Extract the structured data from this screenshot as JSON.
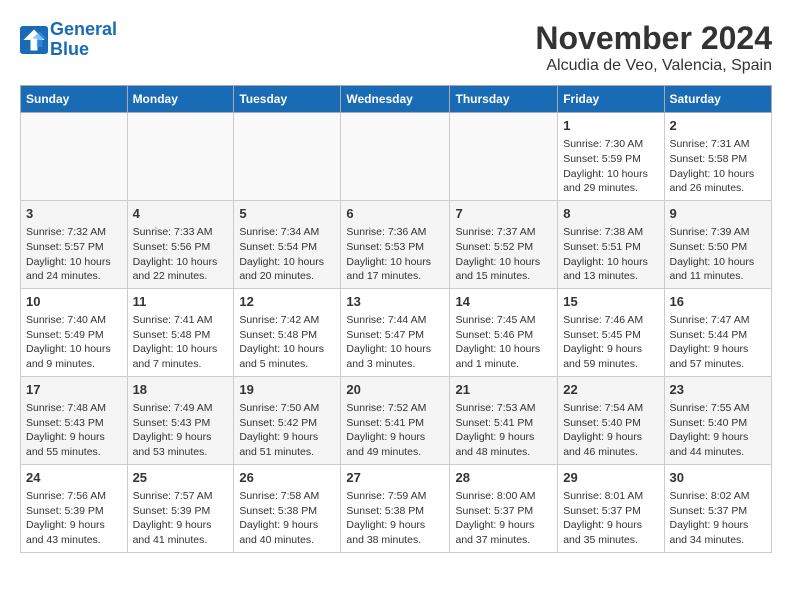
{
  "header": {
    "logo_line1": "General",
    "logo_line2": "Blue",
    "month": "November 2024",
    "location": "Alcudia de Veo, Valencia, Spain"
  },
  "weekdays": [
    "Sunday",
    "Monday",
    "Tuesday",
    "Wednesday",
    "Thursday",
    "Friday",
    "Saturday"
  ],
  "weeks": [
    [
      {
        "day": "",
        "info": ""
      },
      {
        "day": "",
        "info": ""
      },
      {
        "day": "",
        "info": ""
      },
      {
        "day": "",
        "info": ""
      },
      {
        "day": "",
        "info": ""
      },
      {
        "day": "1",
        "info": "Sunrise: 7:30 AM\nSunset: 5:59 PM\nDaylight: 10 hours and 29 minutes."
      },
      {
        "day": "2",
        "info": "Sunrise: 7:31 AM\nSunset: 5:58 PM\nDaylight: 10 hours and 26 minutes."
      }
    ],
    [
      {
        "day": "3",
        "info": "Sunrise: 7:32 AM\nSunset: 5:57 PM\nDaylight: 10 hours and 24 minutes."
      },
      {
        "day": "4",
        "info": "Sunrise: 7:33 AM\nSunset: 5:56 PM\nDaylight: 10 hours and 22 minutes."
      },
      {
        "day": "5",
        "info": "Sunrise: 7:34 AM\nSunset: 5:54 PM\nDaylight: 10 hours and 20 minutes."
      },
      {
        "day": "6",
        "info": "Sunrise: 7:36 AM\nSunset: 5:53 PM\nDaylight: 10 hours and 17 minutes."
      },
      {
        "day": "7",
        "info": "Sunrise: 7:37 AM\nSunset: 5:52 PM\nDaylight: 10 hours and 15 minutes."
      },
      {
        "day": "8",
        "info": "Sunrise: 7:38 AM\nSunset: 5:51 PM\nDaylight: 10 hours and 13 minutes."
      },
      {
        "day": "9",
        "info": "Sunrise: 7:39 AM\nSunset: 5:50 PM\nDaylight: 10 hours and 11 minutes."
      }
    ],
    [
      {
        "day": "10",
        "info": "Sunrise: 7:40 AM\nSunset: 5:49 PM\nDaylight: 10 hours and 9 minutes."
      },
      {
        "day": "11",
        "info": "Sunrise: 7:41 AM\nSunset: 5:48 PM\nDaylight: 10 hours and 7 minutes."
      },
      {
        "day": "12",
        "info": "Sunrise: 7:42 AM\nSunset: 5:48 PM\nDaylight: 10 hours and 5 minutes."
      },
      {
        "day": "13",
        "info": "Sunrise: 7:44 AM\nSunset: 5:47 PM\nDaylight: 10 hours and 3 minutes."
      },
      {
        "day": "14",
        "info": "Sunrise: 7:45 AM\nSunset: 5:46 PM\nDaylight: 10 hours and 1 minute."
      },
      {
        "day": "15",
        "info": "Sunrise: 7:46 AM\nSunset: 5:45 PM\nDaylight: 9 hours and 59 minutes."
      },
      {
        "day": "16",
        "info": "Sunrise: 7:47 AM\nSunset: 5:44 PM\nDaylight: 9 hours and 57 minutes."
      }
    ],
    [
      {
        "day": "17",
        "info": "Sunrise: 7:48 AM\nSunset: 5:43 PM\nDaylight: 9 hours and 55 minutes."
      },
      {
        "day": "18",
        "info": "Sunrise: 7:49 AM\nSunset: 5:43 PM\nDaylight: 9 hours and 53 minutes."
      },
      {
        "day": "19",
        "info": "Sunrise: 7:50 AM\nSunset: 5:42 PM\nDaylight: 9 hours and 51 minutes."
      },
      {
        "day": "20",
        "info": "Sunrise: 7:52 AM\nSunset: 5:41 PM\nDaylight: 9 hours and 49 minutes."
      },
      {
        "day": "21",
        "info": "Sunrise: 7:53 AM\nSunset: 5:41 PM\nDaylight: 9 hours and 48 minutes."
      },
      {
        "day": "22",
        "info": "Sunrise: 7:54 AM\nSunset: 5:40 PM\nDaylight: 9 hours and 46 minutes."
      },
      {
        "day": "23",
        "info": "Sunrise: 7:55 AM\nSunset: 5:40 PM\nDaylight: 9 hours and 44 minutes."
      }
    ],
    [
      {
        "day": "24",
        "info": "Sunrise: 7:56 AM\nSunset: 5:39 PM\nDaylight: 9 hours and 43 minutes."
      },
      {
        "day": "25",
        "info": "Sunrise: 7:57 AM\nSunset: 5:39 PM\nDaylight: 9 hours and 41 minutes."
      },
      {
        "day": "26",
        "info": "Sunrise: 7:58 AM\nSunset: 5:38 PM\nDaylight: 9 hours and 40 minutes."
      },
      {
        "day": "27",
        "info": "Sunrise: 7:59 AM\nSunset: 5:38 PM\nDaylight: 9 hours and 38 minutes."
      },
      {
        "day": "28",
        "info": "Sunrise: 8:00 AM\nSunset: 5:37 PM\nDaylight: 9 hours and 37 minutes."
      },
      {
        "day": "29",
        "info": "Sunrise: 8:01 AM\nSunset: 5:37 PM\nDaylight: 9 hours and 35 minutes."
      },
      {
        "day": "30",
        "info": "Sunrise: 8:02 AM\nSunset: 5:37 PM\nDaylight: 9 hours and 34 minutes."
      }
    ]
  ]
}
